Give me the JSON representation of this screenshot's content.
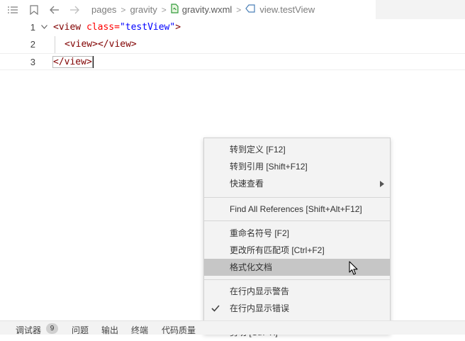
{
  "breadcrumb": {
    "items": [
      "pages",
      "gravity",
      "gravity.wxml",
      "view.testView"
    ],
    "separator": ">"
  },
  "icons": {
    "list": "list-icon",
    "bookmark": "bookmark-icon",
    "back": "arrow-left-icon",
    "forward": "arrow-right-icon",
    "wxml_file": "wxml-file-icon",
    "element": "element-tag-icon"
  },
  "editor": {
    "line_numbers": [
      "1",
      "2",
      "3"
    ],
    "lines": [
      {
        "t1": "<view",
        "attr": " class=",
        "str": "\"testView\"",
        "t2": ">"
      },
      {
        "t1": "<view></view>"
      },
      {
        "t1": "</view>"
      }
    ]
  },
  "context_menu": {
    "items": [
      {
        "label": "转到定义  [F12]"
      },
      {
        "label": "转到引用  [Shift+F12]"
      },
      {
        "label": "快速查看",
        "submenu": true
      },
      {
        "label": "Find All References  [Shift+Alt+F12]"
      },
      {
        "label": "重命名符号  [F2]"
      },
      {
        "label": "更改所有匹配项  [Ctrl+F2]"
      },
      {
        "label": "格式化文档",
        "highlighted": true
      },
      {
        "label": "在行内显示警告"
      },
      {
        "label": "在行内显示错误",
        "checked": true
      },
      {
        "label": "剪切  [Ctrl+X]"
      }
    ]
  },
  "bottom_panel": {
    "tabs": [
      "调试器",
      "问题",
      "输出",
      "终端",
      "代码质量"
    ],
    "debugger_badge": "9"
  },
  "colors": {
    "tag": "#800000",
    "attribute": "#ff0000",
    "string": "#0000ff",
    "menu_highlight": "#c6c6c6"
  }
}
